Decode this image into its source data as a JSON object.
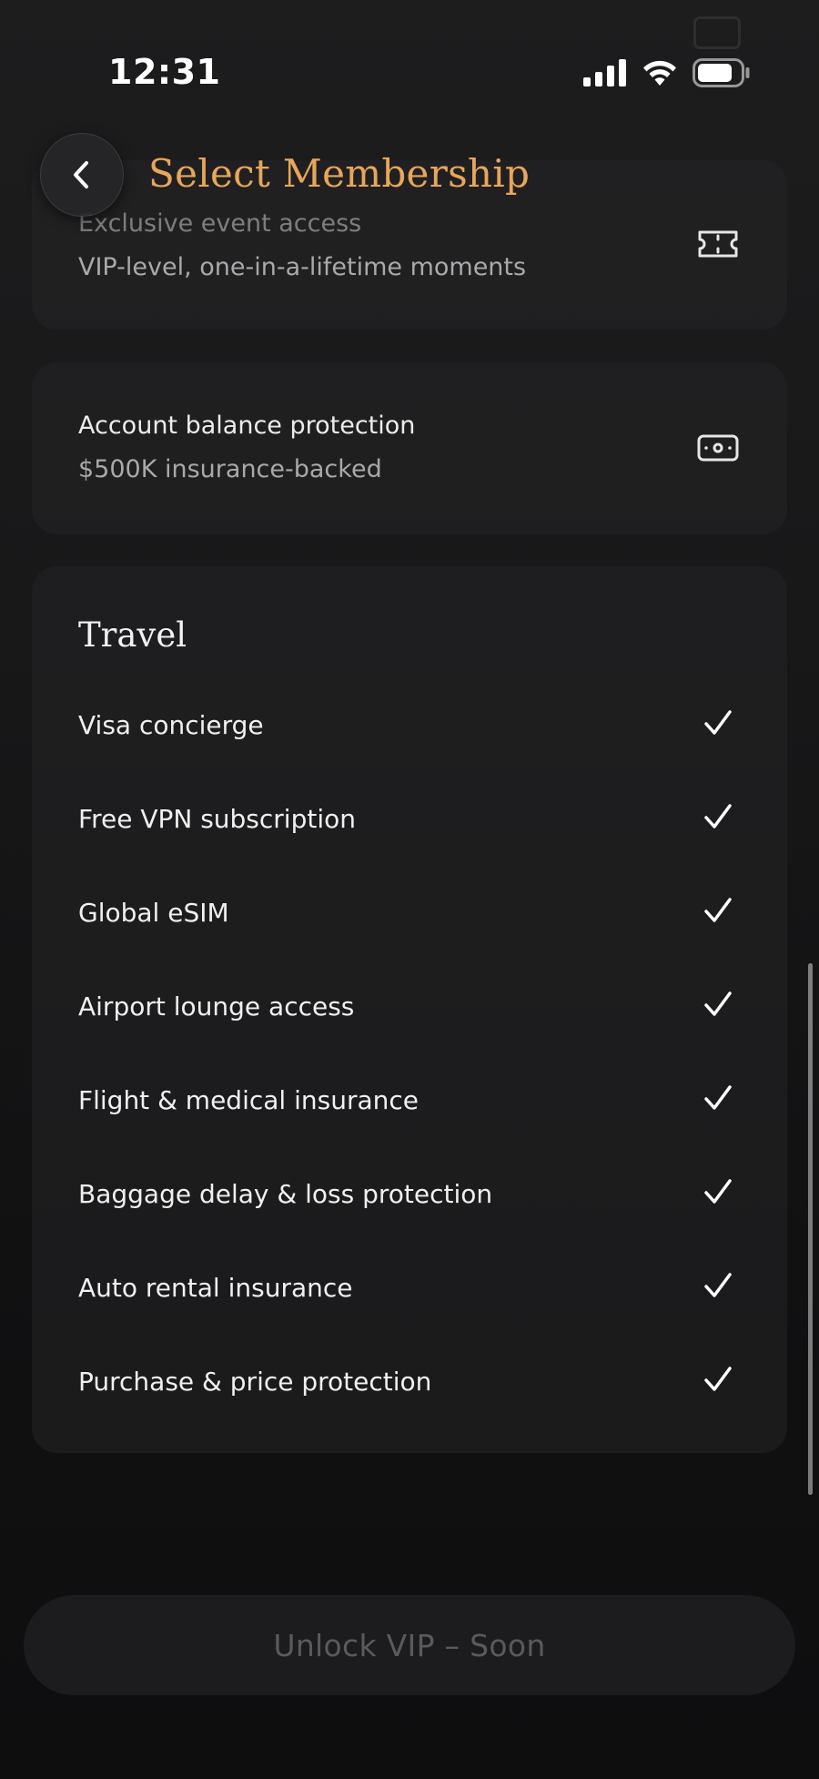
{
  "status_bar": {
    "time": "12:31",
    "icons": [
      "cellular-signal-icon",
      "wifi-icon",
      "battery-icon"
    ]
  },
  "header": {
    "title": "Select Membership",
    "back_icon": "chevron-left-icon"
  },
  "colors": {
    "accent": "#e8a65a",
    "background": "#111112",
    "card": "#242426",
    "muted_text": "#a9a9ab",
    "button_text": "#5a5a5c"
  },
  "features": [
    {
      "title": "Exclusive event access",
      "subtitle": "VIP-level, one-in-a-lifetime moments",
      "icon": "ticket-icon"
    },
    {
      "title": "Account balance protection",
      "subtitle": "$500K insurance-backed",
      "icon": "cash-icon"
    }
  ],
  "travel": {
    "title": "Travel",
    "items": [
      {
        "label": "Visa concierge",
        "icon": "checkmark-icon"
      },
      {
        "label": "Free VPN subscription",
        "icon": "checkmark-icon"
      },
      {
        "label": "Global eSIM",
        "icon": "checkmark-icon"
      },
      {
        "label": "Airport lounge access",
        "icon": "checkmark-icon"
      },
      {
        "label": "Flight & medical insurance",
        "icon": "checkmark-icon"
      },
      {
        "label": "Baggage delay & loss protection",
        "icon": "checkmark-icon"
      },
      {
        "label": "Auto rental insurance",
        "icon": "checkmark-icon"
      },
      {
        "label": "Purchase & price protection",
        "icon": "checkmark-icon"
      }
    ]
  },
  "cta": {
    "label": "Unlock VIP – Soon"
  }
}
